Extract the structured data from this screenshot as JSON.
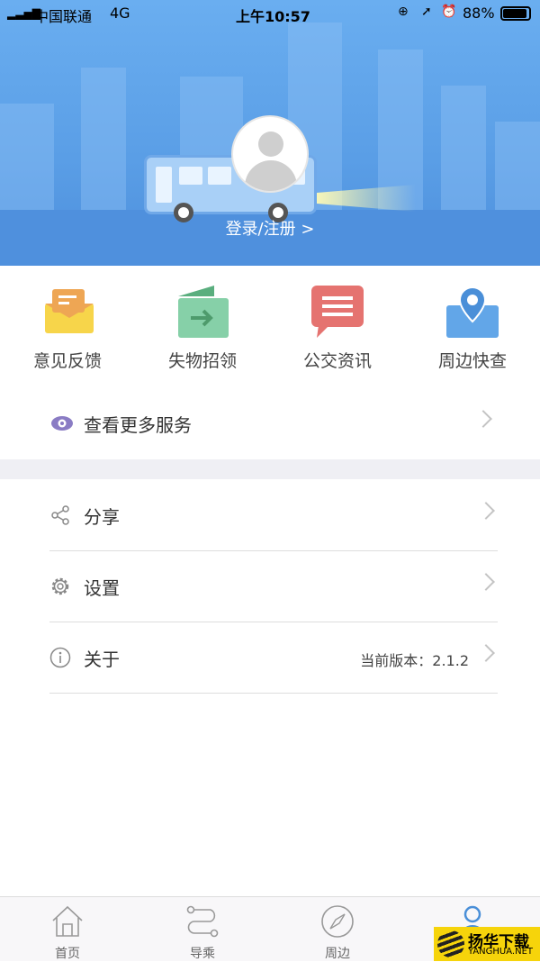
{
  "status_bar": {
    "carrier": "中国联通",
    "network": "4G",
    "time": "上午10:57",
    "battery": "88%"
  },
  "header": {
    "login_label": "登录/注册 >"
  },
  "quick_actions": [
    {
      "label": "意见反馈",
      "icon": "feedback-envelope-icon",
      "color": "#f7d54a"
    },
    {
      "label": "失物招领",
      "icon": "lost-found-icon",
      "color": "#86d0a8"
    },
    {
      "label": "公交资讯",
      "icon": "news-chat-icon",
      "color": "#e57370"
    },
    {
      "label": "周边快查",
      "icon": "map-pin-icon",
      "color": "#62a6e8"
    }
  ],
  "more_services": {
    "label": "查看更多服务"
  },
  "menu": [
    {
      "label": "分享",
      "icon": "share-icon"
    },
    {
      "label": "设置",
      "icon": "gear-icon"
    },
    {
      "label": "关于",
      "icon": "info-icon",
      "value": "当前版本：2.1.2"
    }
  ],
  "tabbar": [
    {
      "label": "首页",
      "icon": "home-icon"
    },
    {
      "label": "导乘",
      "icon": "route-icon"
    },
    {
      "label": "周边",
      "icon": "compass-icon"
    },
    {
      "label": "我的",
      "icon": "user-icon",
      "active": true
    }
  ],
  "watermark": {
    "text": "扬华下载",
    "url_text": "YANGHUA.NET"
  }
}
